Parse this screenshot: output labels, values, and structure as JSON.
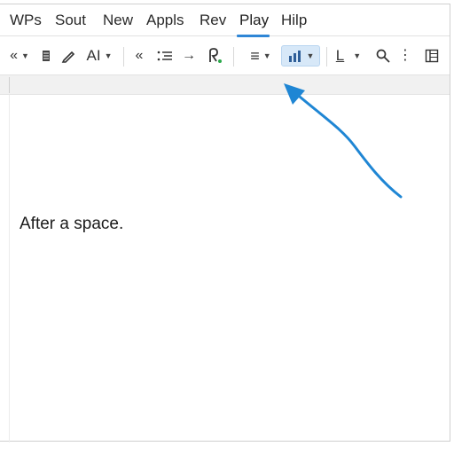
{
  "menubar": {
    "items": [
      {
        "label": "WPs"
      },
      {
        "label": "Sout"
      },
      {
        "label": "New"
      },
      {
        "label": "Appls"
      },
      {
        "label": "Rev"
      },
      {
        "label": "Play"
      },
      {
        "label": "Hilp"
      }
    ],
    "active_index": 5,
    "accent_color": "#2f86d6"
  },
  "toolbar": {
    "undo_redo_glyph": "«",
    "font_label": "AI",
    "left_indent_glyph": "«",
    "redo_glyph": "→",
    "list_glyph": "≡",
    "chart_glyph": "▮",
    "line_style_label": "L",
    "more_glyph": "⋮",
    "highlight_color": "#d7e8f8",
    "icons": [
      "collapse-icon",
      "bookmark-icon",
      "pen-icon",
      "font-style-icon",
      "indent-icon",
      "list-icon",
      "arrow-right-icon",
      "spell-check-icon",
      "align-icon",
      "chart-icon",
      "underline-icon",
      "search-icon",
      "more-icon",
      "columns-icon"
    ]
  },
  "document": {
    "body_text": "After a space."
  },
  "annotation": {
    "arrow_color": "#1f86d4"
  }
}
